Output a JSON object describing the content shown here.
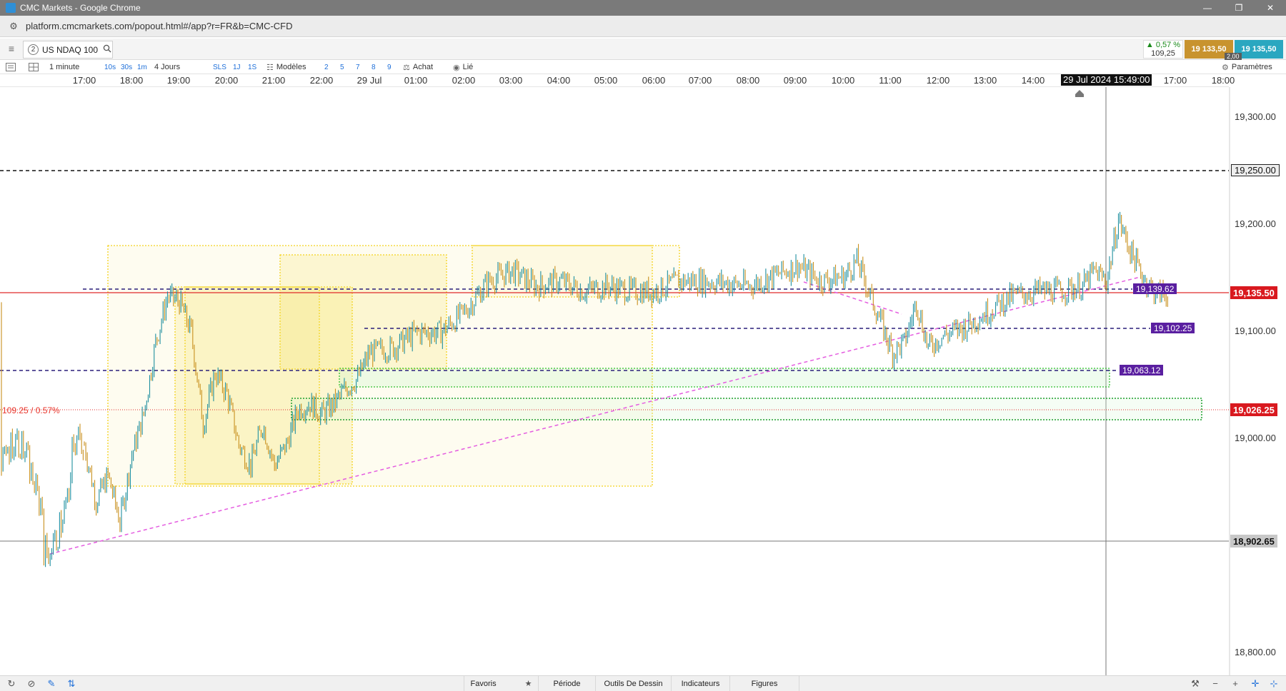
{
  "browser": {
    "window_title": "CMC Markets - Google Chrome",
    "url": "platform.cmcmarkets.com/popout.html#/app?r=FR&b=CMC-CFD",
    "min_glyph": "—",
    "restore_glyph": "❐",
    "close_glyph": "✕"
  },
  "instrument": {
    "tab_number": "2",
    "name": "US NDAQ 100",
    "change_pct": "▲ 0,57 %",
    "change_points": "109,25",
    "sell_price": "19 133,50",
    "buy_price": "19 135,50",
    "spread": "2,00"
  },
  "toolbar": {
    "interval": "1 minute",
    "quick_intervals": [
      "10s",
      "30s",
      "1m"
    ],
    "period": "4 Jours",
    "period_buttons": [
      "SLS",
      "1J",
      "1S"
    ],
    "templates_label": "Modèles",
    "template_numbers": [
      "2",
      "5",
      "7",
      "8",
      "9"
    ],
    "buy_label": "Achat",
    "linked_label": "Lié",
    "settings_label": "Paramètres"
  },
  "time_axis": {
    "labels": [
      "17:00",
      "18:00",
      "19:00",
      "20:00",
      "21:00",
      "22:00",
      "29 Jul",
      "01:00",
      "02:00",
      "03:00",
      "04:00",
      "05:00",
      "06:00",
      "07:00",
      "08:00",
      "09:00",
      "10:00",
      "11:00",
      "12:00",
      "13:00",
      "14:00",
      "17:00",
      "18:00"
    ],
    "crosshair_time": "29 Jul 2024 15:49:00"
  },
  "price_axis": {
    "labels": [
      "19,300.00",
      "19,250.00",
      "19,200.00",
      "19,100.00",
      "19,000.00",
      "18,800.00"
    ],
    "current_price_tag": "19,135.50",
    "reference_tag": "19,026.25",
    "crosshair_tag": "18,902.65"
  },
  "levels": {
    "l1": "19,139.62",
    "l2": "19,102.25",
    "l3": "19,063.12"
  },
  "change_label": "109.25 / 0.57%",
  "colors": {
    "price_line": "#e02a2a",
    "level_line": "#2a1f7a",
    "level_tag": "#5a1fa0",
    "trendline": "#e45ce0",
    "zone_yellow": "#f4d21f",
    "zone_green": "#2fbf2f",
    "candle_up": "#1f8f9f",
    "candle_down": "#c8901e"
  },
  "chart_data": {
    "type": "line",
    "title": "",
    "xlabel": "",
    "ylabel": "",
    "ylim": [
      18790,
      19320
    ],
    "price_series": [
      [
        "17:00",
        18990
      ],
      [
        "17:15",
        18935
      ],
      [
        "17:30",
        18960
      ],
      [
        "17:45",
        18915
      ],
      [
        "18:00",
        18980
      ],
      [
        "18:15",
        19020
      ],
      [
        "18:30",
        19090
      ],
      [
        "18:45",
        19135
      ],
      [
        "19:00",
        19130
      ],
      [
        "19:15",
        19100
      ],
      [
        "19:30",
        19010
      ],
      [
        "19:45",
        19060
      ],
      [
        "20:00",
        19040
      ],
      [
        "20:15",
        18990
      ],
      [
        "20:30",
        18970
      ],
      [
        "20:45",
        19010
      ],
      [
        "21:00",
        18970
      ],
      [
        "21:15",
        18990
      ],
      [
        "21:30",
        19025
      ],
      [
        "21:45",
        19030
      ],
      [
        "22:00",
        19020
      ],
      [
        "22:15",
        19030
      ],
      [
        "22:30",
        19045
      ],
      [
        "22:45",
        19055
      ],
      [
        "23:00",
        19080
      ],
      [
        "23:30",
        19085
      ],
      [
        "00:00",
        19100
      ],
      [
        "00:30",
        19100
      ],
      [
        "01:00",
        19120
      ],
      [
        "01:30",
        19150
      ],
      [
        "02:00",
        19160
      ],
      [
        "02:30",
        19145
      ],
      [
        "03:00",
        19150
      ],
      [
        "03:30",
        19140
      ],
      [
        "04:00",
        19145
      ],
      [
        "04:30",
        19140
      ],
      [
        "05:00",
        19140
      ],
      [
        "05:30",
        19150
      ],
      [
        "06:00",
        19150
      ],
      [
        "06:30",
        19148
      ],
      [
        "07:00",
        19145
      ],
      [
        "07:30",
        19155
      ],
      [
        "08:00",
        19165
      ],
      [
        "08:30",
        19150
      ],
      [
        "09:00",
        19155
      ],
      [
        "09:15",
        19170
      ],
      [
        "09:30",
        19140
      ],
      [
        "09:45",
        19110
      ],
      [
        "10:00",
        19080
      ],
      [
        "10:15",
        19090
      ],
      [
        "10:30",
        19130
      ],
      [
        "10:45",
        19085
      ],
      [
        "11:00",
        19095
      ],
      [
        "11:30",
        19105
      ],
      [
        "12:00",
        19120
      ],
      [
        "12:30",
        19135
      ],
      [
        "13:00",
        19140
      ],
      [
        "13:30",
        19140
      ],
      [
        "14:00",
        19145
      ],
      [
        "14:15",
        19160
      ],
      [
        "14:30",
        19150
      ],
      [
        "14:45",
        19210
      ],
      [
        "15:00",
        19180
      ],
      [
        "15:15",
        19155
      ],
      [
        "15:30",
        19140
      ],
      [
        "15:49",
        19135.5
      ]
    ],
    "horizontal_levels": [
      19250.0,
      19139.62,
      19102.25,
      19063.12,
      19026.25
    ],
    "current_price": 19135.5,
    "grid": false
  }
}
